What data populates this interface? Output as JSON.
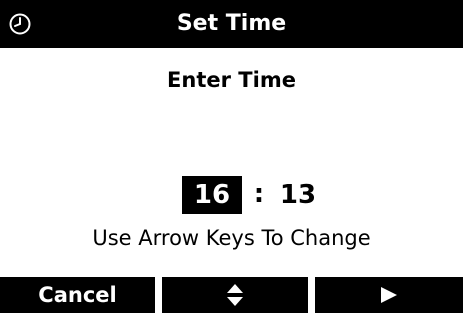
{
  "titlebar": {
    "title": "Set Time",
    "icon": "clock-icon"
  },
  "prompt": "Enter Time",
  "time": {
    "hour": "16",
    "separator": ":",
    "minute": "13",
    "selected_field": "hour"
  },
  "hint": "Use Arrow Keys To Change",
  "softkeys": {
    "cancel_label": "Cancel",
    "updown_icon": "up-down-arrows-icon",
    "next_icon": "right-arrow-icon"
  },
  "colors": {
    "background": "#ffffff",
    "bars": "#000000",
    "text": "#000000",
    "inverse_text": "#ffffff"
  }
}
